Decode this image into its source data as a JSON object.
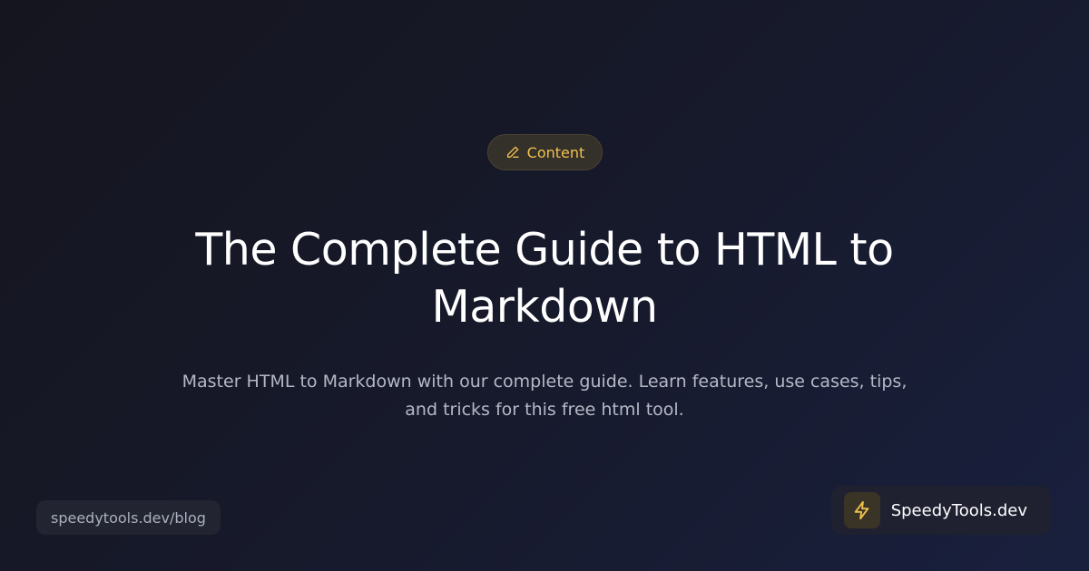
{
  "category": {
    "label": "Content",
    "icon": "pencil-icon",
    "accent": "#f2c14e"
  },
  "title": "The Complete Guide to HTML to Markdown",
  "subtitle": "Master HTML to Markdown with our complete guide. Learn features, use cases, tips, and tricks for this free html tool.",
  "footer": {
    "url": "speedytools.dev/blog",
    "brand": {
      "name": "SpeedyTools.dev",
      "icon": "lightning-bolt-icon"
    }
  },
  "colors": {
    "background_start": "#15151f",
    "background_end": "#19203e",
    "accent": "#f2c14e"
  }
}
